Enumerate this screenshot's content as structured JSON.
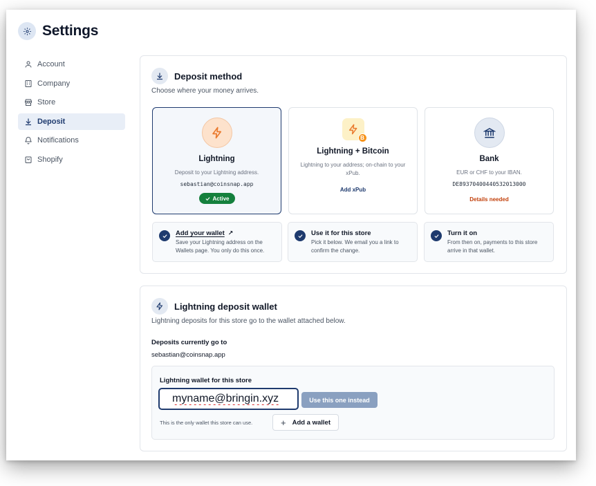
{
  "page": {
    "title": "Settings"
  },
  "sidebar": {
    "items": [
      {
        "label": "Account",
        "icon": "user-icon",
        "active": false
      },
      {
        "label": "Company",
        "icon": "building-icon",
        "active": false
      },
      {
        "label": "Store",
        "icon": "store-icon",
        "active": false
      },
      {
        "label": "Deposit",
        "icon": "download-icon",
        "active": true
      },
      {
        "label": "Notifications",
        "icon": "bell-icon",
        "active": false
      },
      {
        "label": "Shopify",
        "icon": "shopping-bag-icon",
        "active": false
      }
    ]
  },
  "deposit_method": {
    "title": "Deposit method",
    "subtitle": "Choose where your money arrives.",
    "options": [
      {
        "title": "Lightning",
        "description": "Deposit to your Lightning address.",
        "address": "sebastian@coinsnap.app",
        "badge": "Active",
        "icon": "lightning-icon",
        "selected": true
      },
      {
        "title": "Lightning + Bitcoin",
        "description": "Lightning to your address; on-chain to your xPub.",
        "link": "Add xPub",
        "icon": "lightning-bitcoin-icon",
        "selected": false
      },
      {
        "title": "Bank",
        "description": "EUR or CHF to your IBAN.",
        "iban": "DE89370400440532013000",
        "link": "Details needed",
        "icon": "bank-icon",
        "selected": false
      }
    ],
    "steps": [
      {
        "title": "Add your wallet",
        "arrow": "↗",
        "description": "Save your Lightning address on the Wallets page. You only do this once."
      },
      {
        "title": "Use it for this store",
        "description": "Pick it below. We email you a link to confirm the change."
      },
      {
        "title": "Turn it on",
        "description": "From then on, payments to this store arrive in that wallet."
      }
    ]
  },
  "lightning_wallet": {
    "title": "Lightning deposit wallet",
    "subtitle": "Lightning deposits for this store go to the wallet attached below.",
    "current_label": "Deposits currently go to",
    "current_value": "sebastian@coinsnap.app",
    "field_label": "Lightning wallet for this store",
    "input_value": "myname@bringin.xyz",
    "use_button": "Use this one instead",
    "note": "This is the only wallet this store can use.",
    "add_button": "Add a wallet",
    "add_button_icon": "+"
  },
  "colors": {
    "accent": "#1e3a6e",
    "active_badge": "#15803d",
    "warning": "#c2410c",
    "lightning_orange": "#ea7a2e"
  }
}
